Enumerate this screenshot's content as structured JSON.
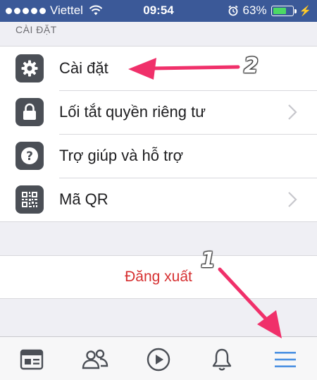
{
  "status_bar": {
    "carrier": "Viettel",
    "time": "09:54",
    "battery_percent": "63%",
    "battery_level": 0.63,
    "icons": [
      "signal-dots-icon",
      "wifi-icon",
      "alarm-icon",
      "battery-icon",
      "charging-icon"
    ]
  },
  "section_header": "CÀI ĐẶT",
  "menu": {
    "items": [
      {
        "label": "Cài đặt",
        "icon": "gear-icon",
        "has_chevron": false
      },
      {
        "label": "Lối tắt quyền riêng tư",
        "icon": "lock-icon",
        "has_chevron": true
      },
      {
        "label": "Trợ giúp và hỗ trợ",
        "icon": "help-icon",
        "has_chevron": false
      },
      {
        "label": "Mã QR",
        "icon": "qr-code-icon",
        "has_chevron": true
      }
    ]
  },
  "logout_label": "Đăng xuất",
  "tab_bar": {
    "tabs": [
      {
        "name": "news-feed",
        "icon": "news-feed-icon"
      },
      {
        "name": "friends",
        "icon": "friends-icon"
      },
      {
        "name": "watch",
        "icon": "play-icon"
      },
      {
        "name": "notifications",
        "icon": "bell-icon"
      },
      {
        "name": "menu",
        "icon": "hamburger-menu-icon",
        "active": true
      }
    ]
  },
  "annotations": {
    "label_1": "1",
    "label_2": "2",
    "arrow_color": "#f0306a"
  },
  "colors": {
    "status_bar_bg": "#3b5998",
    "logout_text": "#d63031",
    "active_tab": "#4a90e2",
    "icon_tile": "#4b4f56"
  }
}
